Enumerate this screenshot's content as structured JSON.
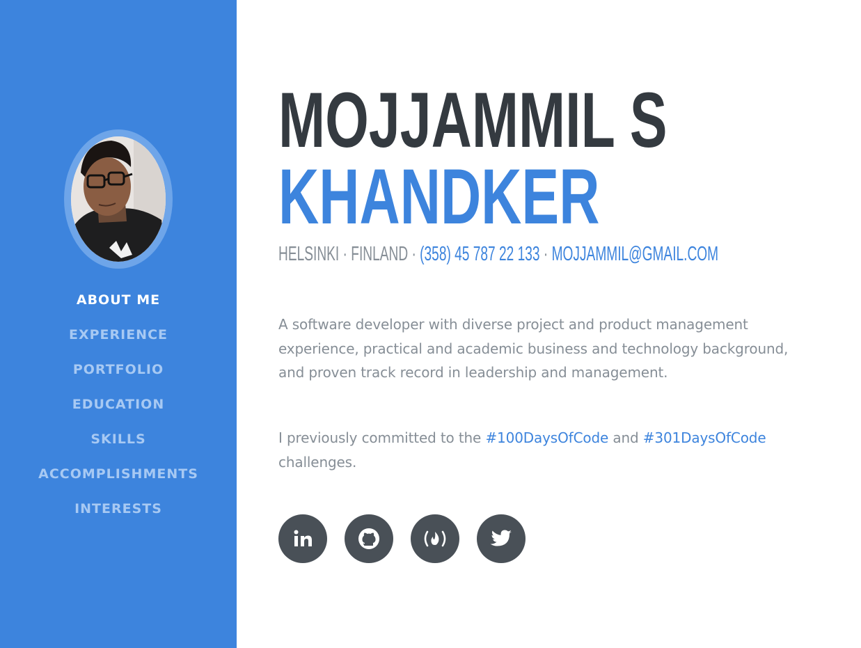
{
  "profile": {
    "first_name": "MOJJAMMIL S",
    "last_name": "KHANDKER",
    "city": "HELSINKI",
    "country": "FINLAND",
    "separator": " · ",
    "phone": "(358) 45 787 22 133",
    "email": "MOJJAMMIL@GMAIL.COM"
  },
  "nav": {
    "items": [
      {
        "label": "ABOUT ME",
        "active": true
      },
      {
        "label": "EXPERIENCE",
        "active": false
      },
      {
        "label": "PORTFOLIO",
        "active": false
      },
      {
        "label": "EDUCATION",
        "active": false
      },
      {
        "label": "SKILLS",
        "active": false
      },
      {
        "label": "ACCOMPLISHMENTS",
        "active": false
      },
      {
        "label": "INTERESTS",
        "active": false
      }
    ]
  },
  "bio": {
    "paragraph1": "A software developer with diverse project and product management experience, practical and academic business and technology background, and proven track record in leadership and management.",
    "p2_before": "I previously committed to the ",
    "p2_link1": "#100DaysOfCode",
    "p2_middle": " and ",
    "p2_link2": "#301DaysOfCode",
    "p2_after": " challenges."
  },
  "social": [
    {
      "name": "linkedin-icon"
    },
    {
      "name": "github-icon"
    },
    {
      "name": "freecodecamp-icon"
    },
    {
      "name": "twitter-icon"
    }
  ],
  "colors": {
    "primary": "#3d84dd",
    "dark_text": "#343a40",
    "muted_text": "#868e96",
    "icon_bg": "#495057",
    "nav_inactive": "#a7c9f3"
  }
}
